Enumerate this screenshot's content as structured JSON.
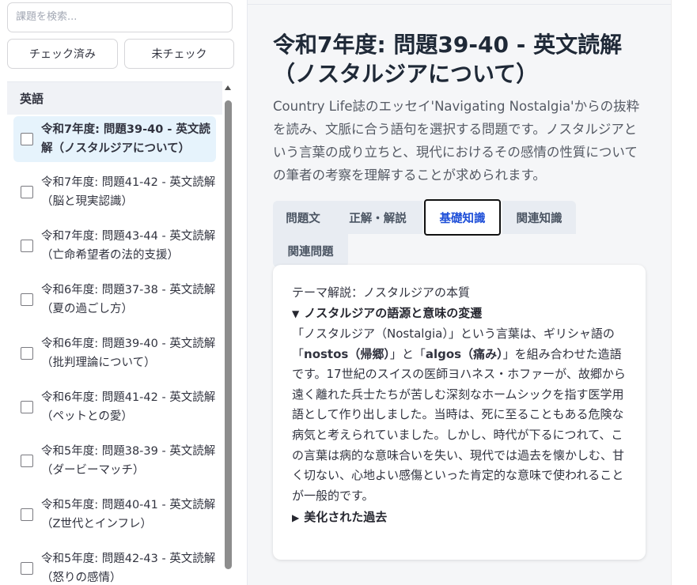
{
  "sidebar": {
    "search_placeholder": "課題を検索...",
    "filter_checked_label": "チェック済み",
    "filter_unchecked_label": "未チェック",
    "group_label": "英語",
    "items": [
      {
        "label": "令和7年度: 問題39-40 - 英文読解（ノスタルジアについて）",
        "selected": true
      },
      {
        "label": "令和7年度: 問題41-42 - 英文読解（脳と現実認識）",
        "selected": false
      },
      {
        "label": "令和7年度: 問題43-44 - 英文読解（亡命希望者の法的支援）",
        "selected": false
      },
      {
        "label": "令和6年度: 問題37-38 - 英文読解（夏の過ごし方）",
        "selected": false
      },
      {
        "label": "令和6年度: 問題39-40 - 英文読解（批判理論について）",
        "selected": false
      },
      {
        "label": "令和6年度: 問題41-42 - 英文読解（ペットとの愛）",
        "selected": false
      },
      {
        "label": "令和5年度: 問題38-39 - 英文読解（ダービーマッチ）",
        "selected": false
      },
      {
        "label": "令和5年度: 問題40-41 - 英文読解（Z世代とインフレ）",
        "selected": false
      },
      {
        "label": "令和5年度: 問題42-43 - 英文読解（怒りの感情）",
        "selected": false
      }
    ]
  },
  "main": {
    "title": "令和7年度: 問題39-40 - 英文読解（ノスタルジアについて）",
    "description": "Country Life誌のエッセイ'Navigating Nostalgia'からの抜粋を読み、文脈に合う語句を選択する問題です。ノスタルジアという言葉の成り立ちと、現代におけるその感情の性質についての筆者の考察を理解することが求められます。",
    "tabs": [
      {
        "label": "問題文",
        "active": false
      },
      {
        "label": "正解・解説",
        "active": false
      },
      {
        "label": "基礎知識",
        "active": true
      },
      {
        "label": "関連知識",
        "active": false
      },
      {
        "label": "関連問題",
        "active": false
      }
    ],
    "content": {
      "section_title": "テーマ解説：ノスタルジアの本質",
      "details_open_title": "ノスタルジアの語源と意味の変遷",
      "body_part1": "「ノスタルジア（Nostalgia）」という言葉は、ギリシャ語の「",
      "body_bold1": "nostos（帰郷）",
      "body_part2": "」と「",
      "body_bold2": "algos（痛み）",
      "body_part3": "」を組み合わせた造語です。17世紀のスイスの医師ヨハネス・ホファーが、故郷から遠く離れた兵士たちが苦しむ深刻なホームシックを指す医学用語として作り出しました。当時は、死に至ることもある危険な病気と考えられていました。しかし、時代が下るにつれて、この言葉は病的な意味合いを失い、現代では過去を懐かしむ、甘く切ない、心地よい感傷といった肯定的な意味で使われることが一般的です。",
      "details_closed_title": "美化された過去",
      "open_marker": "▼",
      "closed_marker": "▶"
    }
  }
}
